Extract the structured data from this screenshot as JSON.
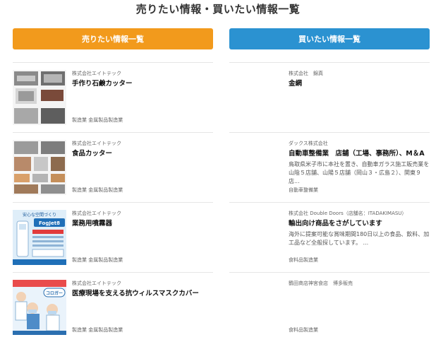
{
  "page_title": "売りたい情報・買いたい情報一覧",
  "sell_header": "売りたい情報一覧",
  "buy_header": "買いたい情報一覧",
  "colors": {
    "sell_accent": "#f29a1c",
    "buy_accent": "#2b92d1"
  },
  "sell_items": [
    {
      "company": "株式会社エイトテック",
      "title": "手作り石鹸カッター",
      "category": "製造業 金属製品製造業",
      "thumb_icon": "soap-cutter-photo"
    },
    {
      "company": "株式会社エイトテック",
      "title": "食品カッター",
      "category": "製造業 金属製品製造業",
      "thumb_icon": "food-cutter-photo"
    },
    {
      "company": "株式会社エイトテック",
      "title": "業務用噴霧器",
      "category": "製造業 金属製品製造業",
      "thumb_icon": "sprayer-flyer",
      "thumb_text": {
        "top": "安心な空間づくり",
        "brand": "FogJet8"
      }
    },
    {
      "company": "株式会社エイトテック",
      "title": "医療現場を支える抗ウィルスマスクカバー",
      "category": "製造業 金属製品製造業",
      "thumb_icon": "mask-cover-flyer",
      "thumb_text": {
        "brand": "コロガー"
      }
    }
  ],
  "buy_items": [
    {
      "company": "株式会社　錦真",
      "title": "金網",
      "description": "",
      "category": ""
    },
    {
      "company": "ダックス株式会社",
      "title": "自動車整備業　店舗（工場、事務所）、M＆A",
      "description": "鳥取県米子市に本社を置き、自動車ガラス施工販売業を山陰５店舗、山陽５店舗（岡山３・広島２）、関東９店...",
      "category": "自動車整備業"
    },
    {
      "company": "株式会社 Double Doors（店舗名：ITADAKIMASU）",
      "title": "輸出向け商品をさがしています",
      "description": "海外に提案可能な賞味期間180日以上の食品、飲料、加工品など全般探しています。 ...",
      "category": "食料品製造業"
    },
    {
      "company": "鶴田商店神宮食店　博多販売",
      "title": "",
      "description": "",
      "category": "食料品製造業"
    }
  ]
}
